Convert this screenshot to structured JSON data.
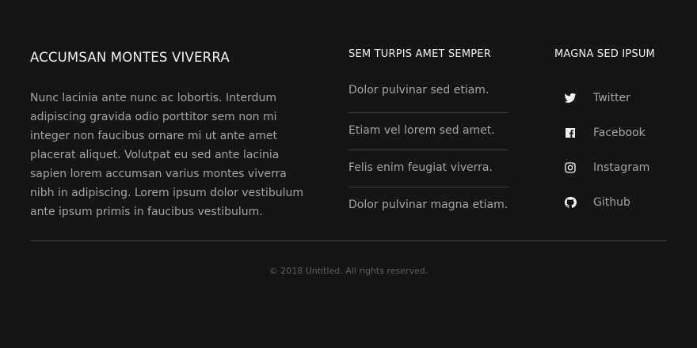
{
  "about": {
    "heading": "ACCUMSAN MONTES VIVERRA",
    "text": "Nunc lacinia ante nunc ac lobortis. Interdum adipiscing gravida odio porttitor sem non mi integer non faucibus ornare mi ut ante amet placerat aliquet. Volutpat eu sed ante lacinia sapien lorem accumsan varius montes viverra nibh in adipiscing. Lorem ipsum dolor vestibulum ante ipsum primis in faucibus vestibulum."
  },
  "links": {
    "heading": "SEM TURPIS AMET SEMPER",
    "items": [
      {
        "label": "Dolor pulvinar sed etiam."
      },
      {
        "label": "Etiam vel lorem sed amet."
      },
      {
        "label": "Felis enim feugiat viverra."
      },
      {
        "label": "Dolor pulvinar magna etiam."
      }
    ]
  },
  "social": {
    "heading": "MAGNA SED IPSUM",
    "items": [
      {
        "label": "Twitter",
        "icon": "twitter-icon"
      },
      {
        "label": "Facebook",
        "icon": "facebook-icon"
      },
      {
        "label": "Instagram",
        "icon": "instagram-icon"
      },
      {
        "label": "Github",
        "icon": "github-icon"
      }
    ]
  },
  "footer": {
    "copyright": "© 2018 Untitled. All rights reserved."
  },
  "colors": {
    "background": "#151516",
    "heading": "#f2f2f2",
    "text": "#a3a3a3",
    "divider": "#3d3d3d",
    "muted": "#5c5c5c"
  }
}
